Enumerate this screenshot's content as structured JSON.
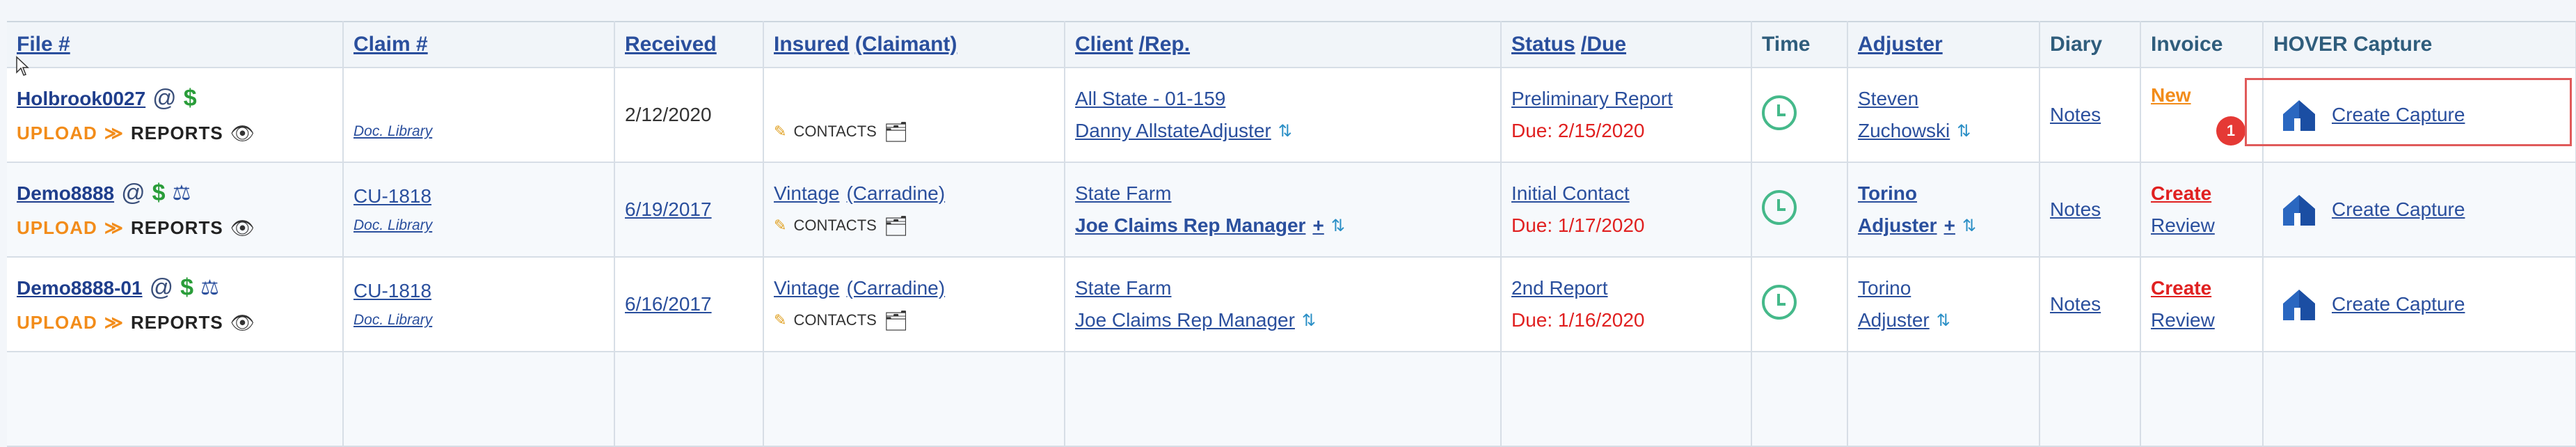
{
  "headers": {
    "file": "File #",
    "claim": "Claim #",
    "received": "Received",
    "insured": "Insured",
    "claimant": "(Claimant)",
    "client": "Client",
    "rep": "/Rep.",
    "status": "Status",
    "due": "/Due",
    "time": "Time",
    "adjuster": "Adjuster",
    "diary": "Diary",
    "invoice": "Invoice",
    "hover": "HOVER Capture"
  },
  "labels": {
    "upload": "UPLOAD",
    "reports": "REPORTS",
    "contacts": "CONTACTS",
    "doc_library": "Doc. Library",
    "notes": "Notes",
    "create_capture": "Create Capture"
  },
  "rows": [
    {
      "file": "Holbrook0027",
      "claim": "",
      "received": "2/12/2020",
      "insured": "",
      "claimant": "",
      "client": "All State - 01-159",
      "rep": "Danny AllstateAdjuster",
      "rep_plus": "",
      "status": "Preliminary Report",
      "due": "Due: 2/15/2020",
      "adjuster_1": "Steven",
      "adjuster_2": "Zuchowski",
      "adjuster_plus": "",
      "invoice_1": "New",
      "invoice_2": "",
      "badge": "1"
    },
    {
      "file": "Demo8888",
      "claim": "CU-1818",
      "received": "6/19/2017",
      "insured": "Vintage",
      "claimant": "(Carradine)",
      "client": "State Farm",
      "rep": "Joe Claims Rep Manager",
      "rep_plus": "+",
      "status": "Initial Contact",
      "due": "Due: 1/17/2020",
      "adjuster_1": "Torino",
      "adjuster_2": "Adjuster",
      "adjuster_plus": "+",
      "invoice_1": "Create",
      "invoice_2": "Review",
      "badge": ""
    },
    {
      "file": "Demo8888-01",
      "claim": "CU-1818",
      "received": "6/16/2017",
      "insured": "Vintage",
      "claimant": "(Carradine)",
      "client": "State Farm",
      "rep": "Joe Claims Rep Manager",
      "rep_plus": "",
      "status": "2nd Report",
      "due": "Due: 1/16/2020",
      "adjuster_1": "Torino",
      "adjuster_2": "Adjuster",
      "adjuster_plus": "",
      "invoice_1": "Create",
      "invoice_2": "Review",
      "badge": ""
    }
  ]
}
